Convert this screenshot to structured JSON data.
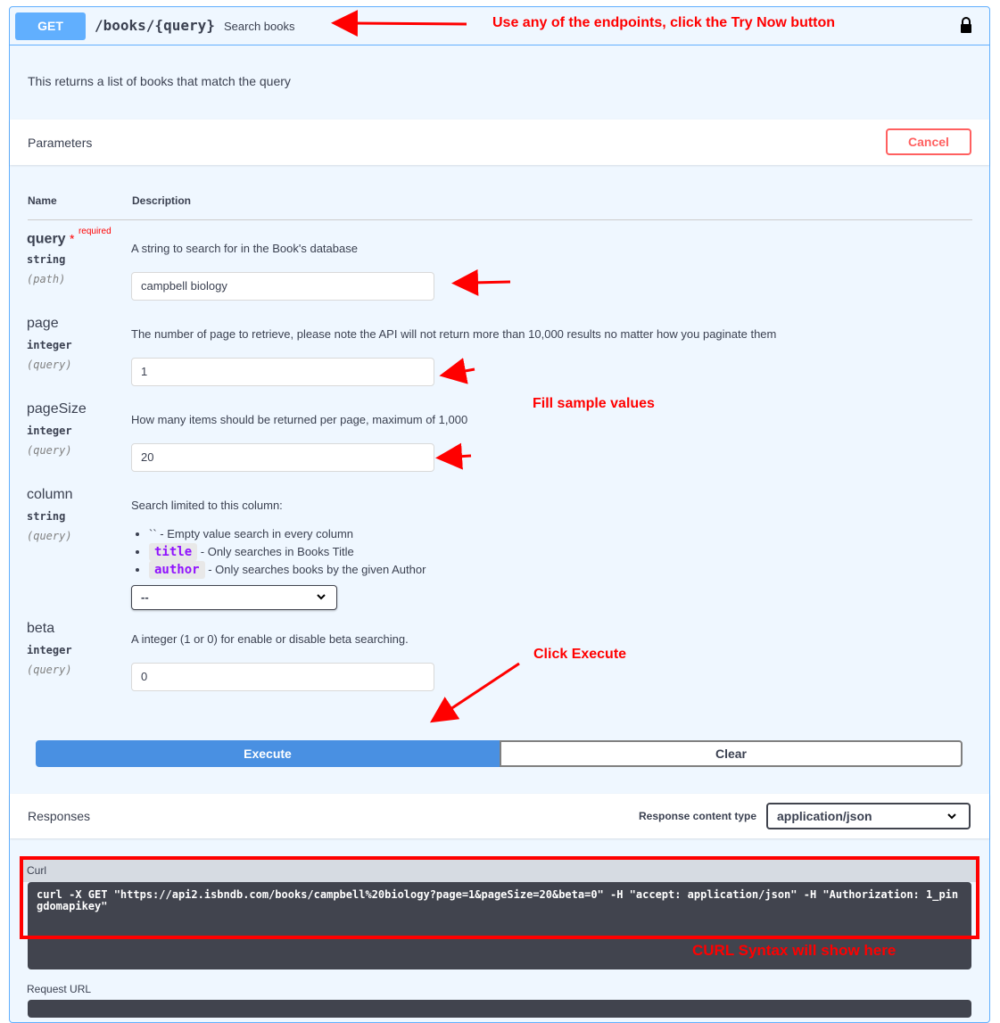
{
  "operation": {
    "method": "GET",
    "path": "/books/{query}",
    "summary": "Search books",
    "description": "This returns a list of books that match the query"
  },
  "parameters": {
    "title": "Parameters",
    "cancel": "Cancel",
    "col_name": "Name",
    "col_desc": "Description",
    "required_label": "required",
    "required_star": "*",
    "items": [
      {
        "name": "query",
        "type": "string",
        "in": "(path)",
        "description": "A string to search for in the Book's database",
        "value": "campbell biology"
      },
      {
        "name": "page",
        "type": "integer",
        "in": "(query)",
        "description": "The number of page to retrieve, please note the API will not return more than 10,000 results no matter how you paginate them",
        "value": "1"
      },
      {
        "name": "pageSize",
        "type": "integer",
        "in": "(query)",
        "description": "How many items should be returned per page, maximum of 1,000",
        "value": "20"
      },
      {
        "name": "column",
        "type": "string",
        "in": "(query)",
        "description": "Search limited to this column:",
        "options": [
          {
            "code": "``",
            "text": " - Empty value search in every column"
          },
          {
            "code": "title",
            "text": " - Only searches in Books Title"
          },
          {
            "code": "author",
            "text": " - Only searches books by the given Author"
          }
        ],
        "selected": "--"
      },
      {
        "name": "beta",
        "type": "integer",
        "in": "(query)",
        "description": "A integer (1 or 0) for enable or disable beta searching.",
        "value": "0"
      }
    ]
  },
  "actions": {
    "execute": "Execute",
    "clear": "Clear"
  },
  "responses": {
    "title": "Responses",
    "content_type_label": "Response content type",
    "content_type": "application/json",
    "curl_label": "Curl",
    "curl": "curl -X GET \"https://api2.isbndb.com/books/campbell%20biology?page=1&pageSize=20&beta=0\" -H \"accept: application/json\" -H \"Authorization: 1_pingdomapikey\"",
    "request_url_label": "Request URL"
  },
  "annotations": {
    "top": "Use any of the endpoints, click the Try Now button",
    "fill": "Fill sample values",
    "execute": "Click Execute",
    "curl": "CURL Syntax will show here"
  },
  "colors": {
    "method": "#61affe",
    "annotation": "#ff0000",
    "execute": "#4990e2",
    "code_bg": "#41444e"
  }
}
